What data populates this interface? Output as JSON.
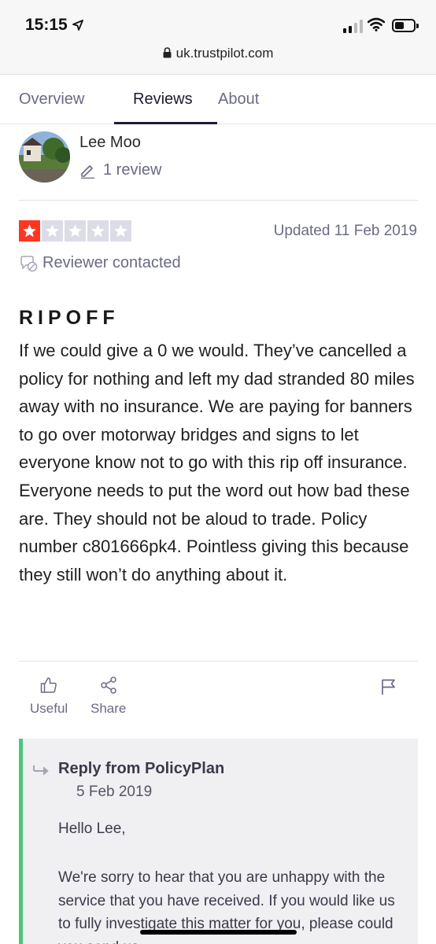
{
  "status_bar": {
    "time": "15:15"
  },
  "browser": {
    "url": "uk.trustpilot.com"
  },
  "tabs": [
    {
      "label": "Overview",
      "active": false
    },
    {
      "label": "Reviews",
      "active": true
    },
    {
      "label": "About",
      "active": false
    }
  ],
  "reviewer": {
    "name": "Lee Moo",
    "review_count": "1 review"
  },
  "review": {
    "rating": 1,
    "rating_max": 5,
    "updated": "Updated 11 Feb 2019",
    "contacted": "Reviewer contacted",
    "title": "RIPOFF",
    "body": "If we could give a 0 we would. They’ve cancelled a policy for nothing and left my dad stranded 80 miles away with no insurance. We are paying for banners to go over motorway bridges and signs to let everyone know not to go with this rip off insurance. Everyone needs to put the word out how bad these are. They should not be aloud to trade. Policy number c801666pk4. Pointless giving this because they still won’t do anything about it."
  },
  "actions": {
    "useful": "Useful",
    "share": "Share"
  },
  "reply": {
    "title": "Reply from PolicyPlan",
    "date": "5 Feb 2019",
    "greeting": "Hello Lee,",
    "text": "We're sorry to hear that you are unhappy with the service that you have received. If you would like us to fully investigate this matter for you, please could you send us"
  },
  "colors": {
    "star_red": "#ff3722",
    "reply_accent": "#4fc47e",
    "tab_underline": "#1c1c3a"
  }
}
